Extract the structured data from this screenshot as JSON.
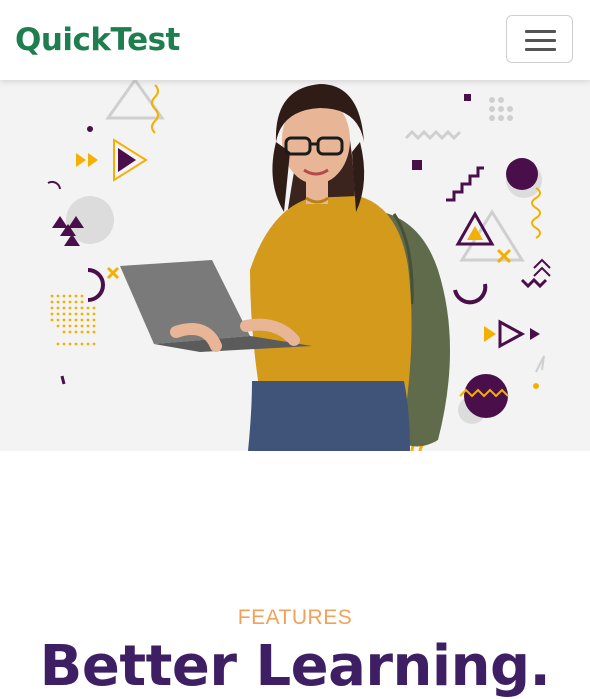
{
  "navbar": {
    "brand": "QuickTest",
    "menu_toggle_icon": "hamburger-menu-icon"
  },
  "hero": {
    "image": "student-with-laptop-and-backpack-illustration",
    "colors": {
      "background": "#f3f3f3",
      "shirt": "#d49a1c",
      "backpack": "#5f6b4a",
      "accent_purple": "#4a0f4a",
      "accent_yellow": "#f4b000"
    }
  },
  "features": {
    "label": "FEATURES",
    "title": "Better Learning."
  },
  "colors": {
    "brand": "#1e7e4f",
    "features_label": "#f2a15b",
    "title": "#3f1f63"
  }
}
